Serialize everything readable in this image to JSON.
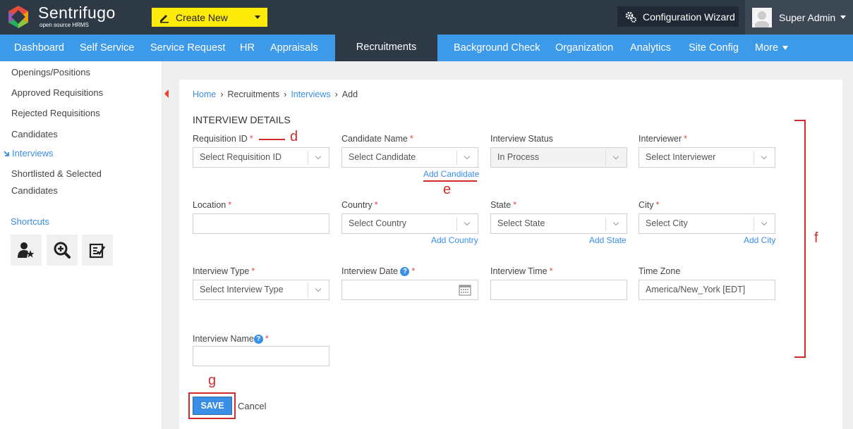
{
  "app": {
    "brand": "Sentrifugo",
    "brand_sub": "open source HRMS"
  },
  "topbar": {
    "create_new": "Create New",
    "config_wizard": "Configuration Wizard",
    "user_name": "Super Admin"
  },
  "nav": [
    "Dashboard",
    "Self Service",
    "Service Request",
    "HR",
    "Appraisals",
    "Recruitments",
    "Background Check",
    "Organization",
    "Analytics",
    "Site Config",
    "More"
  ],
  "nav_active": "Recruitments",
  "sidebar": {
    "items": [
      "Openings/Positions",
      "Approved Requisitions",
      "Rejected Requisitions",
      "Candidates",
      "Interviews",
      "Shortlisted & Selected",
      "Candidates"
    ],
    "active": "Interviews",
    "shortcuts_title": "Shortcuts",
    "shortcut_icons": [
      "user-star-icon",
      "zoom-in-icon",
      "checklist-icon"
    ]
  },
  "breadcrumb": {
    "home": "Home",
    "recruitments": "Recruitments",
    "interviews": "Interviews",
    "current": "Add",
    "separator": "›"
  },
  "form": {
    "section_title": "INTERVIEW DETAILS",
    "required_mark": "*",
    "help_mark": "?",
    "requisition_id": {
      "label": "Requisition ID",
      "placeholder": "Select Requisition ID"
    },
    "candidate_name": {
      "label": "Candidate Name",
      "placeholder": "Select Candidate",
      "add_link": "Add Candidate"
    },
    "interview_status": {
      "label": "Interview Status",
      "value": "In Process"
    },
    "interviewer": {
      "label": "Interviewer",
      "placeholder": "Select Interviewer"
    },
    "location": {
      "label": "Location",
      "value": ""
    },
    "country": {
      "label": "Country",
      "placeholder": "Select Country",
      "add_link": "Add Country"
    },
    "state": {
      "label": "State",
      "placeholder": "Select State",
      "add_link": "Add State"
    },
    "city": {
      "label": "City",
      "placeholder": "Select City",
      "add_link": "Add City"
    },
    "interview_type": {
      "label": "Interview Type",
      "placeholder": "Select Interview Type"
    },
    "interview_date": {
      "label": "Interview Date",
      "value": ""
    },
    "interview_time": {
      "label": "Interview Time",
      "value": ""
    },
    "time_zone": {
      "label": "Time Zone",
      "value": "America/New_York [EDT]"
    },
    "interview_name": {
      "label": "Interview Name",
      "value": ""
    },
    "save": "SAVE",
    "cancel": "Cancel"
  },
  "annotations": {
    "d": "d",
    "e": "e",
    "f": "f",
    "g": "g"
  },
  "colors": {
    "nav_bg": "#3d9ae8",
    "topbar_bg": "#2e3946",
    "create_btn": "#ffeb0a",
    "link": "#3a8ee6",
    "annotation": "#d12b2b"
  }
}
